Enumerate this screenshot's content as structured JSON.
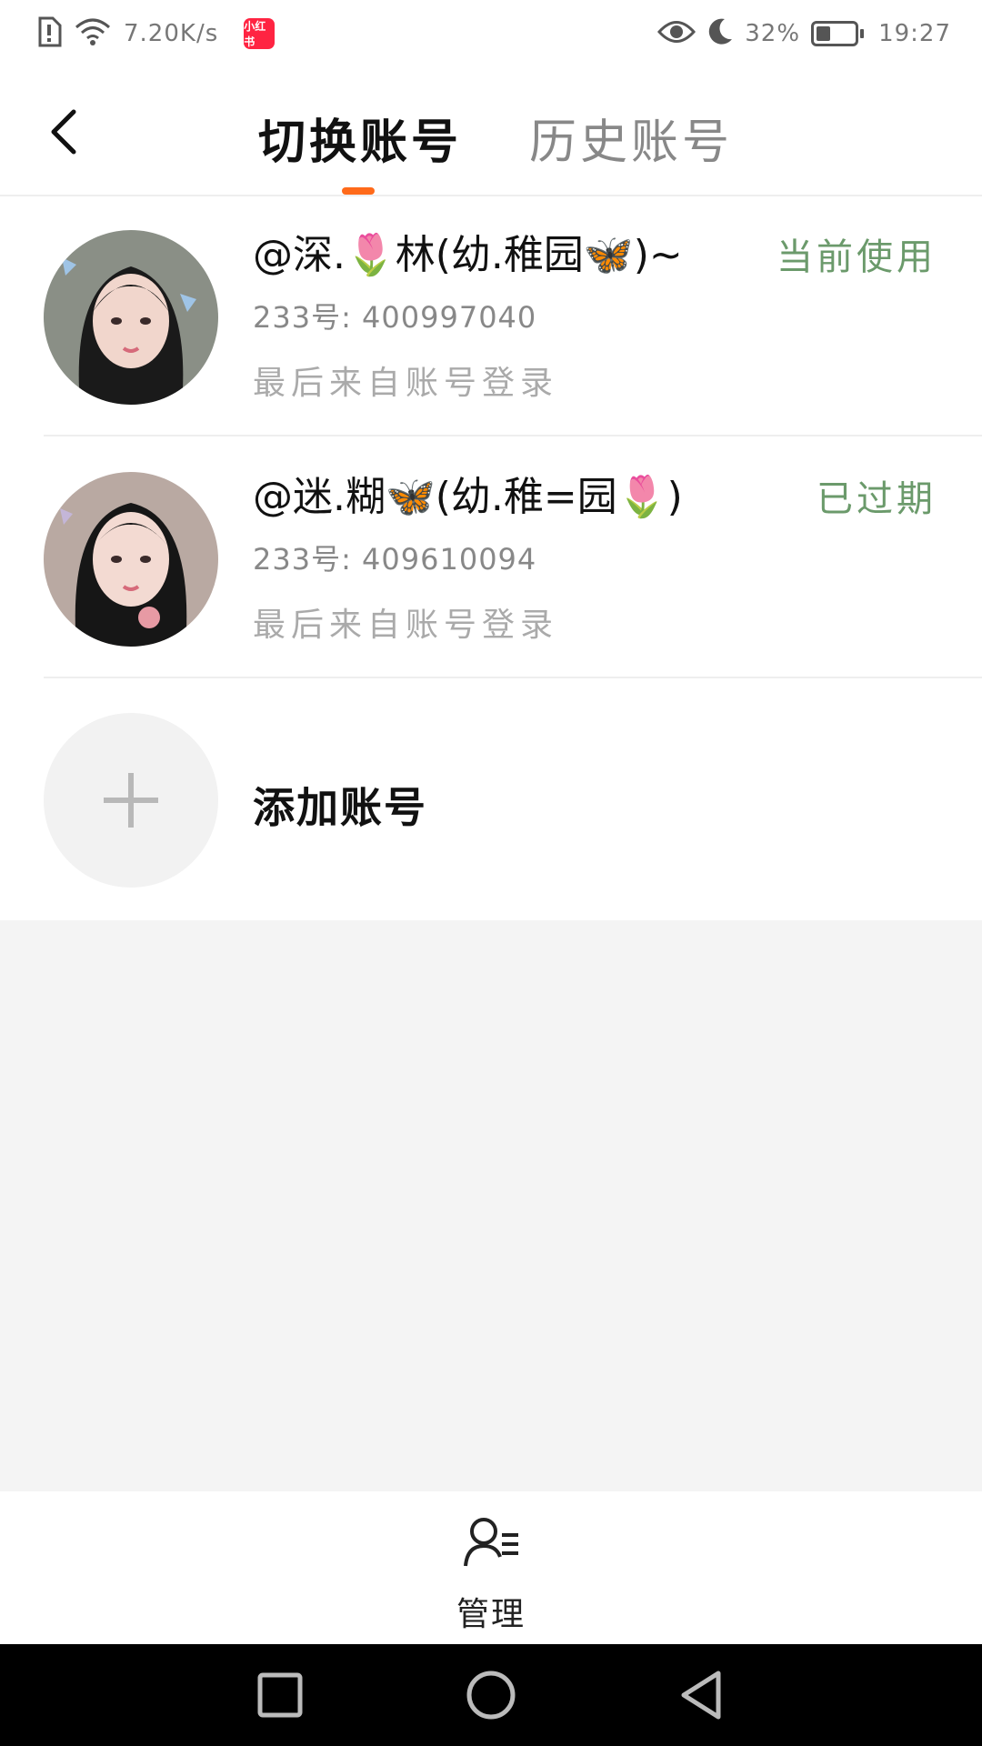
{
  "status_bar": {
    "net_speed": "7.20K/s",
    "app_badge": "小红书",
    "battery": "32%",
    "battery_level": 0.32,
    "time": "19:27"
  },
  "header": {
    "tabs": [
      {
        "label": "切换账号",
        "active": true
      },
      {
        "label": "历史账号",
        "active": false
      }
    ],
    "accent_color": "#ff6a1a"
  },
  "accounts": [
    {
      "name": "@深.🌷林(幼.稚园🦋)~",
      "id_text": "233号: 400997040",
      "source": "最后来自账号登录",
      "status": "当前使用"
    },
    {
      "name": "@迷.糊🦋(幼.稚=园🌷)",
      "id_text": "233号: 409610094",
      "source": "最后来自账号登录",
      "status": "已过期"
    }
  ],
  "add_account": {
    "label": "添加账号",
    "icon": "plus-icon"
  },
  "bottom": {
    "manage_label": "管理",
    "icon": "user-manage-icon"
  },
  "status_color": "#6b9a6b"
}
